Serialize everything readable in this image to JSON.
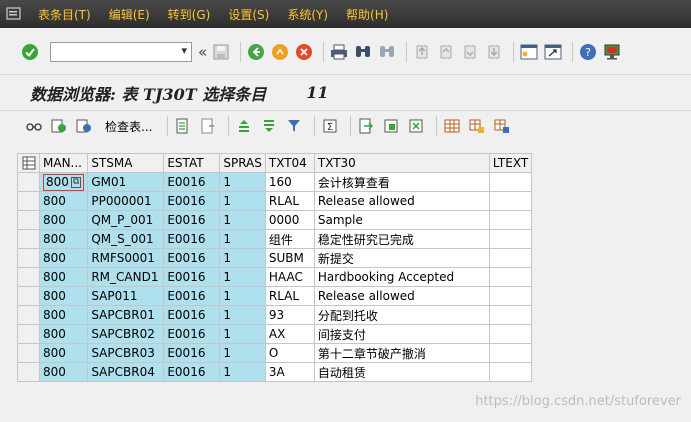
{
  "menu": {
    "items": [
      "表条目(T)",
      "编辑(E)",
      "转到(G)",
      "设置(S)",
      "系统(Y)",
      "帮助(H)"
    ]
  },
  "toolbar": {
    "command_field_value": "",
    "icons": [
      "enter-icon",
      "save-icon",
      "back-icon",
      "exit-icon",
      "cancel-icon",
      "print-icon",
      "find-icon",
      "find-next-icon",
      "first-page-icon",
      "previous-page-icon",
      "next-page-icon",
      "last-page-icon",
      "new-session-icon",
      "shortcut-icon",
      "help-icon",
      "customize-layout-icon"
    ]
  },
  "title": {
    "text": "数据浏览器: 表 TJ30T 选择条目",
    "count": "11"
  },
  "app_toolbar": {
    "check_table_label": "检查表..."
  },
  "table": {
    "columns": [
      "MAN...",
      "STSMA",
      "ESTAT",
      "SPRAS",
      "TXT04",
      "TXT30",
      "LTEXT"
    ],
    "rows": [
      [
        "800",
        "GM01",
        "E0016",
        "1",
        "160",
        "会计核算查看",
        ""
      ],
      [
        "800",
        "PP000001",
        "E0016",
        "1",
        "RLAL",
        "Release allowed",
        ""
      ],
      [
        "800",
        "QM_P_001",
        "E0016",
        "1",
        "0000",
        "Sample",
        ""
      ],
      [
        "800",
        "QM_S_001",
        "E0016",
        "1",
        "组件",
        "稳定性研究已完成",
        ""
      ],
      [
        "800",
        "RMFS0001",
        "E0016",
        "1",
        "SUBM",
        "新提交",
        ""
      ],
      [
        "800",
        "RM_CAND1",
        "E0016",
        "1",
        "HAAC",
        "Hardbooking Accepted",
        ""
      ],
      [
        "800",
        "SAP011",
        "E0016",
        "1",
        "RLAL",
        "Release allowed",
        ""
      ],
      [
        "800",
        "SAPCBR01",
        "E0016",
        "1",
        "93",
        "分配到托收",
        ""
      ],
      [
        "800",
        "SAPCBR02",
        "E0016",
        "1",
        "AX",
        "间接支付",
        ""
      ],
      [
        "800",
        "SAPCBR03",
        "E0016",
        "1",
        "O",
        "第十二章节破产撤消",
        ""
      ],
      [
        "800",
        "SAPCBR04",
        "E0016",
        "1",
        "3A",
        "自动租赁",
        ""
      ]
    ]
  },
  "watermark": "https://blog.csdn.net/stuforever",
  "colors": {
    "menu_text": "#ffc52c",
    "key_cell": "#aee0ee",
    "menubar_bg": "#353535"
  }
}
